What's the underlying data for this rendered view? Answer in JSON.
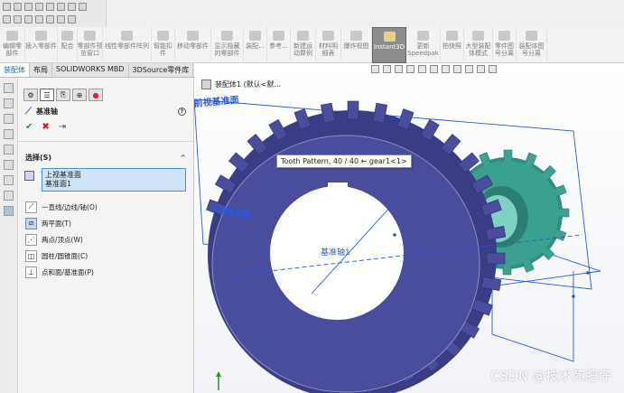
{
  "ribbon": {
    "buttons": [
      {
        "label": "编辑零\n部件"
      },
      {
        "label": "插入零部件"
      },
      {
        "label": "配合"
      },
      {
        "label": "零部件预\n览窗口"
      },
      {
        "label": "线性零部件阵列"
      },
      {
        "label": "智能扣\n件"
      },
      {
        "label": "移动零部件"
      },
      {
        "label": "显示隐藏\n的零部件"
      },
      {
        "label": "装配..."
      },
      {
        "label": "参考..."
      },
      {
        "label": "新建运\n动算例"
      },
      {
        "label": "材料明\n细表"
      },
      {
        "label": "爆炸视图"
      },
      {
        "label": "Instant3D"
      },
      {
        "label": "更新\nSpeedpak"
      },
      {
        "label": "拍快照"
      },
      {
        "label": "大型装配\n体模式"
      },
      {
        "label": "零件图\n号分离"
      },
      {
        "label": "装配体图\n号分离"
      }
    ],
    "active": "Instant3D"
  },
  "tabs": [
    {
      "label": "装配体"
    },
    {
      "label": "布局"
    },
    {
      "label": "SOLIDWORKS MBD"
    },
    {
      "label": "3DSource零件库"
    }
  ],
  "panel": {
    "feature_title": "基准轴",
    "help": "?",
    "ok": "✔",
    "cancel": "✖",
    "pin": "⇥",
    "section_title": "选择(S)",
    "section_chevron": "^",
    "selections": [
      "上视基准面",
      "基准面1"
    ],
    "options": [
      {
        "label": "一直线/边线/轴(O)",
        "selected": false
      },
      {
        "label": "两平面(T)",
        "selected": true
      },
      {
        "label": "两点/顶点(W)",
        "selected": false
      },
      {
        "label": "圆柱/圆锥面(C)",
        "selected": false
      },
      {
        "label": "点和面/基准面(P)",
        "selected": false
      }
    ]
  },
  "viewport": {
    "breadcrumb": "装配体1 (默认<默...",
    "tooltip": "Tooth Pattern, 40 / 40 ← gear1<1>",
    "plane_label": "前视基准面",
    "plane_label2": "上视基准面",
    "axis_label": "基准轴1",
    "watermark": "CSDN @技术死肥仔",
    "colors": {
      "gear_large": "#4a4d9e",
      "gear_small": "#3ea192",
      "preview_blue": "#2b58e0"
    }
  }
}
